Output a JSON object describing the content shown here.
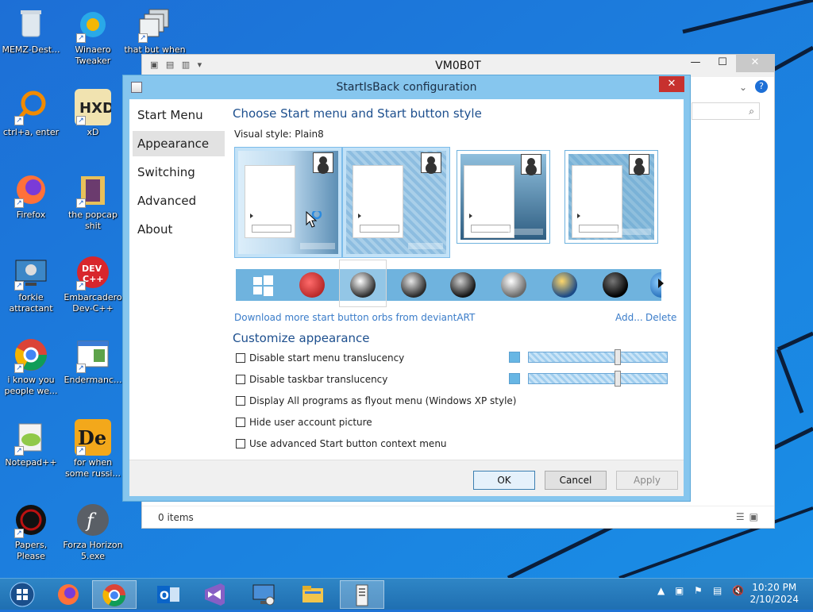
{
  "desktop": {
    "icons": [
      {
        "label": "MEMZ-Dest..."
      },
      {
        "label": "Winaero Tweaker"
      },
      {
        "label": "that but when"
      },
      {
        "label": "ctrl+a, enter"
      },
      {
        "label": "xD"
      },
      {
        "label": "Firefox"
      },
      {
        "label": "the popcap shit"
      },
      {
        "label": "forkie attractant"
      },
      {
        "label": "Embarcadero Dev-C++"
      },
      {
        "label": "i know you people we..."
      },
      {
        "label": "Endermanc..."
      },
      {
        "label": "Notepad++"
      },
      {
        "label": "for when some russi..."
      },
      {
        "label": "Papers, Please"
      },
      {
        "label": "Forza Horizon 5.exe"
      }
    ]
  },
  "explorer": {
    "title": "VM0B0T",
    "status": "0 items"
  },
  "dialog": {
    "title": "StartIsBack configuration",
    "nav": [
      "Start Menu",
      "Appearance",
      "Switching",
      "Advanced",
      "About"
    ],
    "heading": "Choose Start menu and Start button style",
    "visual_style_label": "Visual style:",
    "visual_style_value": "Plain8",
    "download_link": "Download more start button orbs from deviantART",
    "add_link": "Add...",
    "delete_link": "Delete",
    "customize_heading": "Customize appearance",
    "options": [
      "Disable start menu translucency",
      "Disable taskbar translucency",
      "Display All programs as flyout menu (Windows XP style)",
      "Hide user account picture",
      "Use advanced Start button context menu"
    ],
    "ok": "OK",
    "cancel": "Cancel",
    "apply": "Apply",
    "slider_levels": [
      0.65,
      0.65
    ],
    "accent_color": "#67b6e4"
  },
  "taskbar": {
    "apps": [
      "start-orb",
      "firefox",
      "chrome",
      "outlook",
      "visual-studio",
      "remote-desktop",
      "file-explorer",
      "startisback"
    ],
    "time": "10:20 PM",
    "date": "2/10/2024"
  }
}
